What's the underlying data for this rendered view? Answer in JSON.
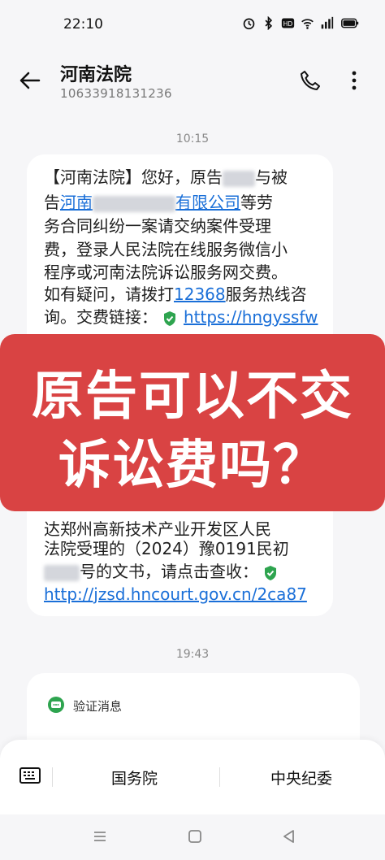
{
  "status_bar": {
    "time": "22:10"
  },
  "header": {
    "contact_name": "河南法院",
    "contact_number": "10633918131236"
  },
  "conversation": {
    "timestamp_1": "10:15",
    "message_1": {
      "lines": [
        {
          "a": "【河南法院】您好，原告",
          "b": "与被"
        },
        {
          "a": "告",
          "link": "河南",
          "link2": "有限公司",
          "b": "等劳"
        },
        {
          "a": "务合同纠纷一案请交纳案件受理"
        },
        {
          "a": "费，登录人民法院在线服务微信小"
        },
        {
          "a": "程序或河南法院诉讼服务网交费。"
        },
        {
          "a": "如有疑问，请拨打",
          "link": "12368",
          "b": "服务热线咨"
        },
        {
          "a": "询。交费链接：",
          "link": "https://hngyssfw"
        },
        {
          "a": "达郑州高新技术产业开发区人民"
        },
        {
          "a": "法院受理的（2024）豫0191民初"
        },
        {
          "a": "号的文书，请点击查收："
        },
        {
          "link": "http://jzsd.hncourt.gov.cn/2ca87"
        }
      ]
    },
    "timestamp_2": "19:43",
    "message_2": {
      "label": "验证消息"
    }
  },
  "banner": {
    "line1": "原告可以不交",
    "line2": "诉讼费吗？",
    "color": "#d94343"
  },
  "bottom_menu": {
    "item1": "国务院",
    "item2": "中央纪委"
  },
  "colors": {
    "link": "#1a6fd8",
    "background": "#f6f6f8",
    "shield_green": "#2ea44f"
  }
}
